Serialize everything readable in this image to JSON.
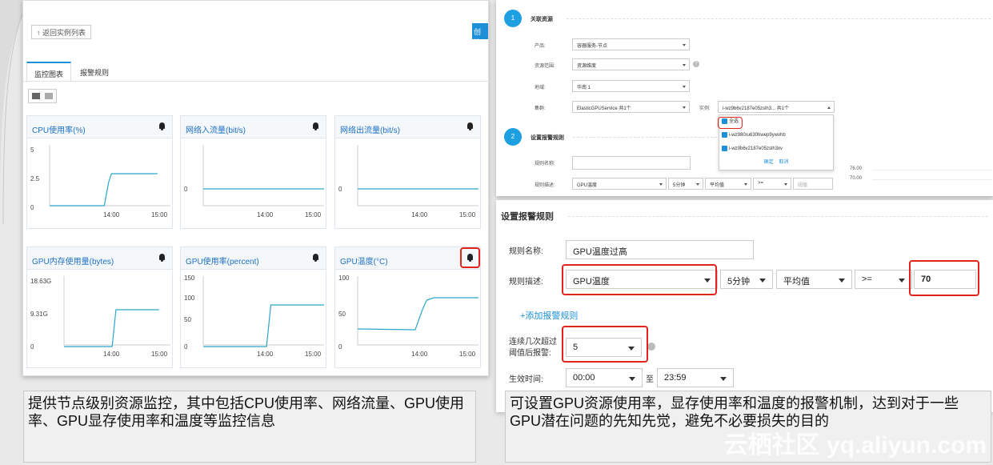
{
  "left": {
    "back_btn": "↑ 返回实例列表",
    "create_btn": "创建",
    "tabs": [
      "监控图表",
      "报警规则"
    ],
    "panels": [
      {
        "title": "CPU使用率(%)",
        "yticks": [
          "5",
          "2.5",
          "0"
        ],
        "xticks": [
          "14:00",
          "15:00"
        ]
      },
      {
        "title": "网络入流量(bit/s)",
        "yticks": [
          "0"
        ],
        "xticks": [
          "14:00",
          "15:00"
        ]
      },
      {
        "title": "网络出流量(bit/s)",
        "yticks": [
          "0"
        ],
        "xticks": [
          "14:00",
          "15:00"
        ]
      },
      {
        "title": "GPU内存使用量(bytes)",
        "yticks": [
          "18.63G",
          "9.31G",
          "0"
        ],
        "xticks": [
          "14:00",
          "15:00"
        ]
      },
      {
        "title": "GPU使用率(percent)",
        "yticks": [
          "150",
          "100",
          "50",
          "0"
        ],
        "xticks": [
          "14:00",
          "15:00"
        ]
      },
      {
        "title": "GPU温度(°C)",
        "yticks": [
          "100",
          "50",
          "0"
        ],
        "xticks": [
          "14:00",
          "15:00"
        ]
      }
    ]
  },
  "rt": {
    "step1": "1",
    "sec1": "关联资源",
    "product_lbl": "产品:",
    "product_val": "容器服务-节点",
    "scope_lbl": "资源范围:",
    "scope_val": "资源维度",
    "region_lbl": "地域:",
    "region_val": "华南 1",
    "cluster_lbl": "集群:",
    "cluster_val": "ElasticGPUService 共1个",
    "inst_lbl": "实例:",
    "inst_val": "i-wz9b6v2187e05zslh3... 共1个",
    "dd_all": "全选",
    "dd_item1": "i-wz980ru630hwep9ywvhb",
    "dd_item2": "i-wz9b6v2187e05zslh3xv",
    "dd_ok": "确定",
    "dd_cancel": "取消",
    "step2": "2",
    "sec2": "设置报警规则",
    "rule_name_lbl": "规则名称:",
    "rule_desc_lbl": "规则描述:",
    "metric": "GPU温度",
    "period": "5分钟",
    "agg": "平均值",
    "op": ">=",
    "thr_placeholder": "阈值",
    "chart_ticks": [
      "76.00",
      "70.00"
    ]
  },
  "rb": {
    "section": "设置报警规则",
    "rule_name_lbl": "规则名称:",
    "rule_name_val": "GPU温度过高",
    "rule_desc_lbl": "规则描述:",
    "metric": "GPU温度",
    "period": "5分钟",
    "agg": "平均值",
    "op": ">=",
    "threshold": "70",
    "add_rule": "+添加报警规则",
    "times_lbl_1": "连续几次超过",
    "times_lbl_2": "阈值后报警:",
    "times_val": "5",
    "effective_lbl": "生效时间:",
    "start": "00:00",
    "to": "至",
    "end": "23:59"
  },
  "captions": {
    "left": "提供节点级别资源监控，其中包括CPU使用率、网络流量、GPU使用率、GPU显存使用率和温度等监控信息",
    "right": "可设置GPU资源使用率，显存使用率和温度的报警机制，达到对于一些GPU潜在问题的先知先觉，避免不必要损失的目的"
  },
  "watermark": "云栖社区 yq.aliyun.com",
  "colors": {
    "accent": "#1e90d8",
    "line": "#2aa6c8",
    "highlight": "#e0241b"
  }
}
